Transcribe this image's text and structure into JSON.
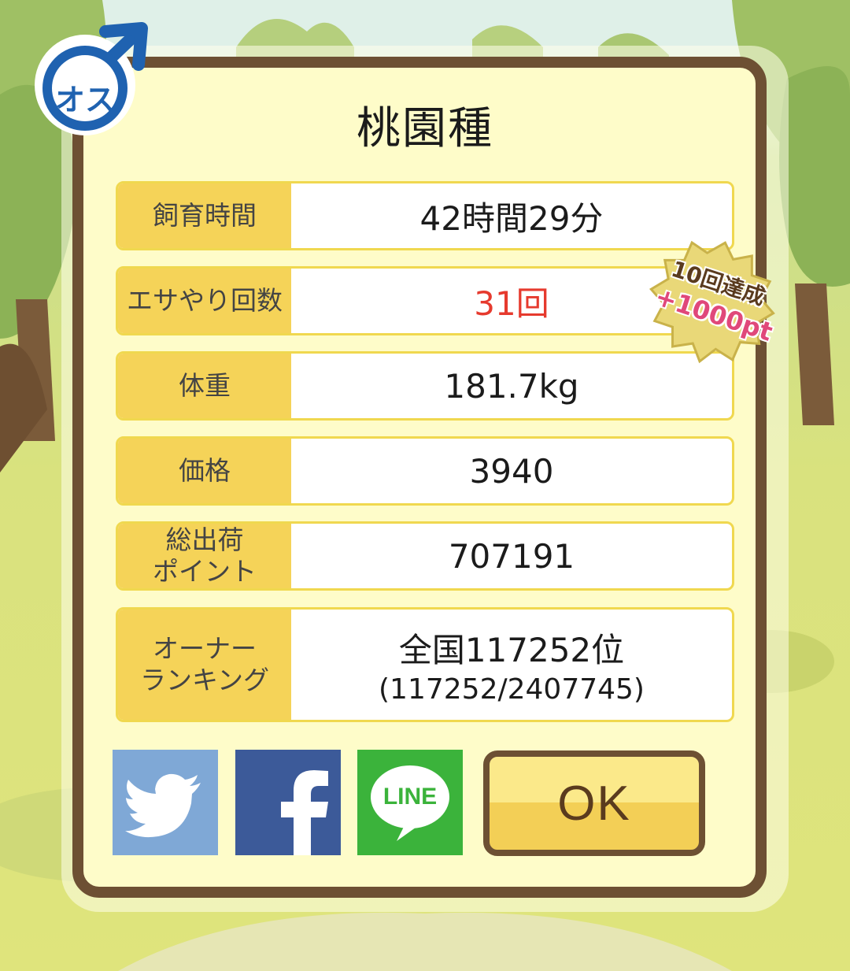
{
  "gender": {
    "symbol_icon": "male-symbol-icon",
    "label": "オス"
  },
  "title": "桃園種",
  "stats": [
    {
      "label": "飼育時間",
      "value": "42時間29分"
    },
    {
      "label": "エサやり回数",
      "value": "31回",
      "color": "#e63a2e"
    },
    {
      "label": "体重",
      "value": "181.7kg"
    },
    {
      "label": "価格",
      "value": "3940"
    },
    {
      "label": "総出荷\nポイント",
      "value": "707191"
    },
    {
      "label": "オーナー\nランキング",
      "value": "全国117252位",
      "sub": "(117252/2407745)"
    }
  ],
  "badge": {
    "line1": "10回達成",
    "line2": "+1000pt"
  },
  "share": {
    "twitter_icon": "twitter-bird-icon",
    "facebook_icon": "facebook-f-icon",
    "line_label": "LINE"
  },
  "ok_label": "OK",
  "colors": {
    "frame": "#6d5033",
    "panel": "#fefcc9",
    "label_bg": "#f5d358",
    "accent_red": "#e63a2e",
    "twitter": "#7fa8d6",
    "facebook": "#3c5a99",
    "line": "#3bb33b"
  }
}
